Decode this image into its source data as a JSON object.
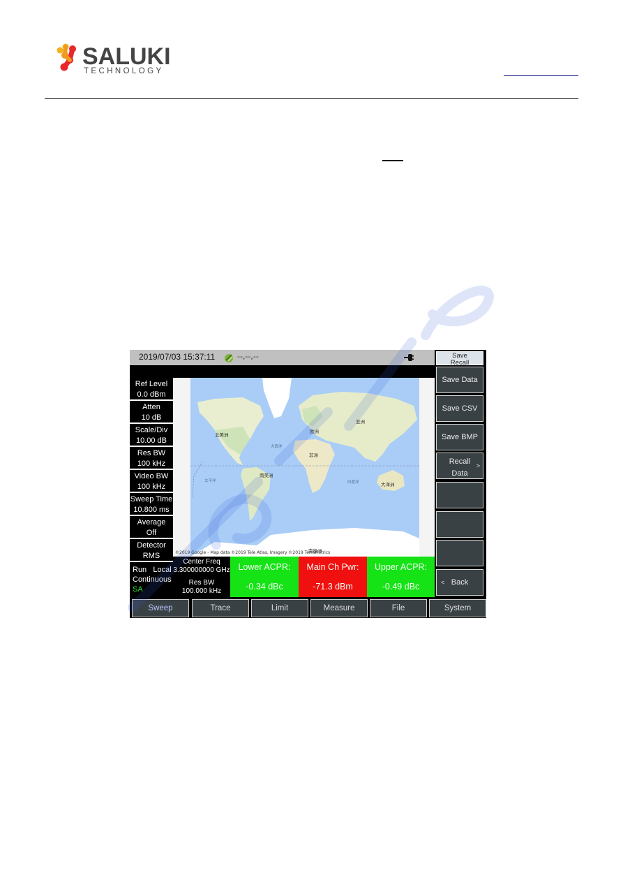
{
  "header": {
    "logo_name": "SALUKI",
    "logo_sub": "TECHNOLOGY"
  },
  "screen": {
    "status": {
      "datetime": "2019/07/03  15:37:11",
      "gps_text": "--,--,--"
    },
    "params": [
      {
        "label": "Ref Level",
        "value": "0.0 dBm"
      },
      {
        "label": "Atten",
        "value": "10 dB"
      },
      {
        "label": "Scale/Div",
        "value": "10.00 dB"
      },
      {
        "label": "Res BW",
        "value": "100 kHz"
      },
      {
        "label": "Video BW",
        "value": "100 kHz"
      },
      {
        "label": "Sweep Time",
        "value": "10.800 ms"
      },
      {
        "label": "Average",
        "value": "Off"
      },
      {
        "label": "Detector",
        "value": "RMS"
      }
    ],
    "run": {
      "run": "Run",
      "local": "Local",
      "mode": "Continuous",
      "app": "SA"
    },
    "map": {
      "labels": {
        "north_america": "北美洲",
        "south_america": "南美洲",
        "europe": "欧洲",
        "africa": "非洲",
        "asia": "亚洲",
        "oceania": "大洋洲",
        "antarctica": "南极洲",
        "atlantic": "大西洋",
        "pacific": "太平洋",
        "indian": "印度洋"
      },
      "attribution": "©2019 Google - Map data ©2019 Tele Atlas, Imagery ©2019 TerraMetrics"
    },
    "freq": {
      "center_label": "Center Freq",
      "center_value": "3.300000000 GHz",
      "rbw_label": "Res BW",
      "rbw_value": "100.000 kHz"
    },
    "measurements": [
      {
        "label": "Lower ACPR:",
        "value": "-0.34 dBc",
        "color": "#16e316"
      },
      {
        "label": "Main Ch Pwr:",
        "value": "-71.3 dBm",
        "color": "#f01010"
      },
      {
        "label": "Upper ACPR:",
        "value": "-0.49 dBc",
        "color": "#16e316"
      }
    ],
    "menu": {
      "title_line1": "Save",
      "title_line2": "Recall",
      "keys": [
        {
          "label": "Save Data"
        },
        {
          "label": "Save CSV"
        },
        {
          "label": "Save BMP"
        },
        {
          "line1": "Recall",
          "line2": "Data",
          "arrow": ">"
        },
        {
          "label": ""
        },
        {
          "label": ""
        },
        {
          "label": ""
        },
        {
          "label": "Back",
          "arrow": "<"
        }
      ]
    },
    "tabs": [
      "Sweep",
      "Trace",
      "Limit",
      "Measure",
      "File",
      "System"
    ],
    "active_tab": "Sweep"
  }
}
